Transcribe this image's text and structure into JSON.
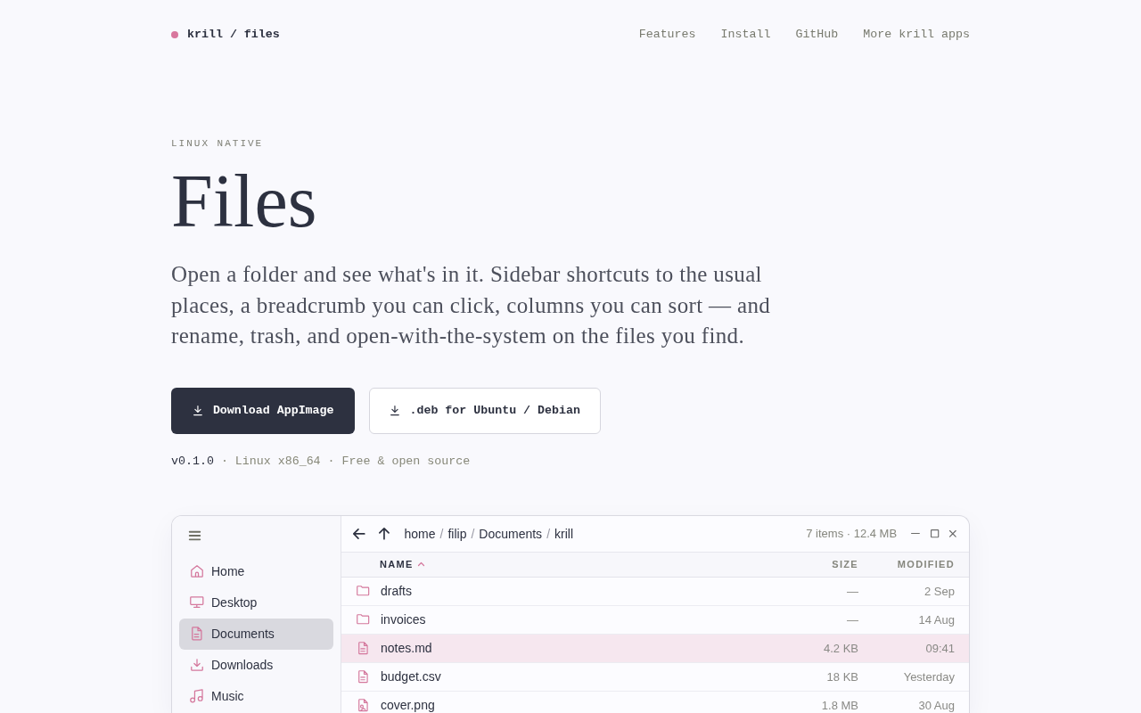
{
  "nav": {
    "brand": "krill / files",
    "links": [
      "Features",
      "Install",
      "GitHub",
      "More krill apps"
    ]
  },
  "hero": {
    "eyebrow": "LINUX NATIVE",
    "title": "Files",
    "lead": "Open a folder and see what's in it. Sidebar shortcuts to the usual places, a breadcrumb you can click, columns you can sort — and rename, trash, and open-with-the-system on the files you find.",
    "buttons": [
      {
        "kind": "primary",
        "label": "Download AppImage"
      },
      {
        "kind": "secondary",
        "label": ".deb for Ubuntu / Debian"
      }
    ],
    "version": "v0.1.0",
    "details": "· Linux x86_64 · Free & open source"
  },
  "file_manager": {
    "sidebar": {
      "items": [
        {
          "kind": "home",
          "label": "Home",
          "selected": false
        },
        {
          "kind": "desktop",
          "label": "Desktop",
          "selected": false
        },
        {
          "kind": "documents",
          "label": "Documents",
          "selected": true
        },
        {
          "kind": "downloads",
          "label": "Downloads",
          "selected": false
        },
        {
          "kind": "music",
          "label": "Music",
          "selected": false
        }
      ]
    },
    "toolbar": {
      "breadcrumb": [
        {
          "kind": "crumb",
          "label": "home"
        },
        {
          "kind": "separator",
          "label": "/"
        },
        {
          "kind": "crumb",
          "label": "filip"
        },
        {
          "kind": "separator",
          "label": "/"
        },
        {
          "kind": "crumb",
          "label": "Documents"
        },
        {
          "kind": "separator",
          "label": "/"
        },
        {
          "kind": "crumb",
          "label": "krill"
        }
      ],
      "summary": "7 items · 12.4 MB"
    },
    "table": {
      "columns": [
        {
          "label": "NAME",
          "sorted": true
        },
        {
          "label": "SIZE",
          "sorted": false
        },
        {
          "label": "MODIFIED",
          "sorted": false
        }
      ],
      "rows": [
        {
          "kind": "folder",
          "name": "drafts",
          "size": "—",
          "modified": "2 Sep",
          "selected": false
        },
        {
          "kind": "folder",
          "name": "invoices",
          "size": "—",
          "modified": "14 Aug",
          "selected": false
        },
        {
          "kind": "document",
          "name": "notes.md",
          "size": "4.2 KB",
          "modified": "09:41",
          "selected": true
        },
        {
          "kind": "document",
          "name": "budget.csv",
          "size": "18 KB",
          "modified": "Yesterday",
          "selected": false
        },
        {
          "kind": "image",
          "name": "cover.png",
          "size": "1.8 MB",
          "modified": "30 Aug",
          "selected": false
        }
      ]
    }
  }
}
